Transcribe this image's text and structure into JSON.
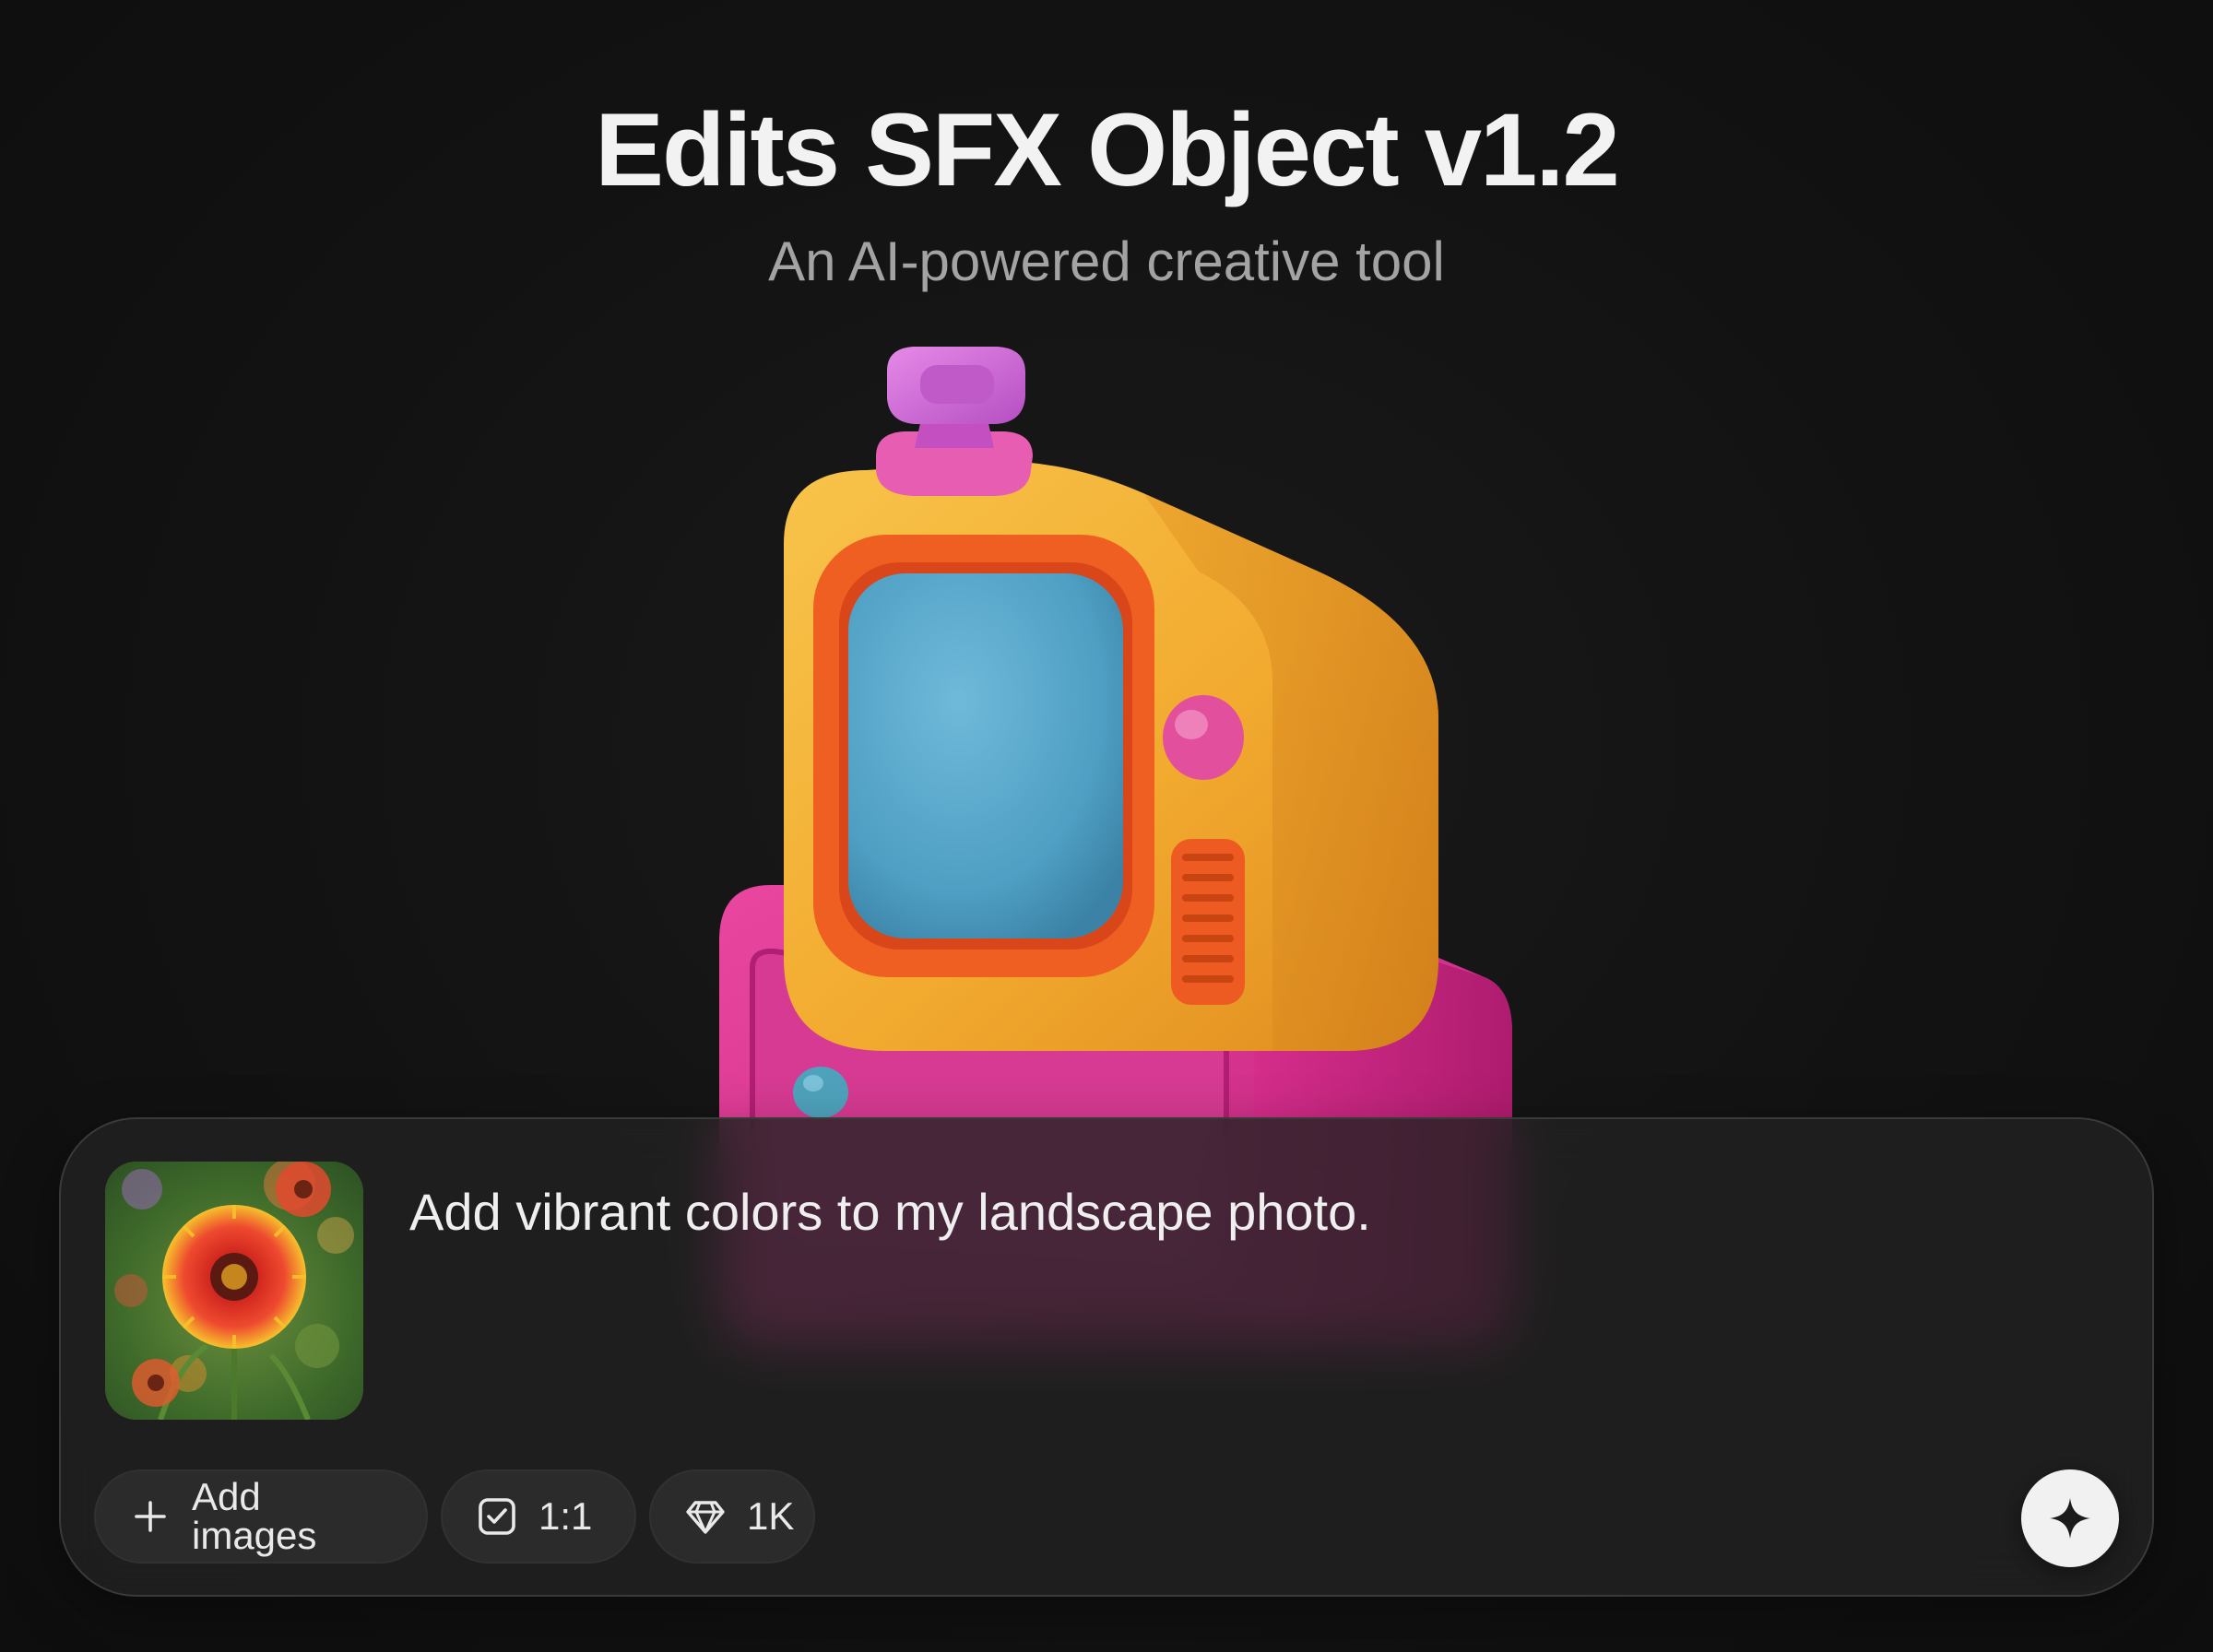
{
  "header": {
    "title": "Edits SFX Object v1.2",
    "subtitle": "An AI-powered creative tool"
  },
  "hero": {
    "image_icon": "retro-tv-3d-icon",
    "colors": {
      "tv_body": "#F2AA2F",
      "tv_bezel": "#F05F22",
      "screen": "#4E9FC3",
      "cabinet": "#D92D8E",
      "antenna": "#D065D8",
      "knob": "#E24F9C",
      "drawer_knob": "#4FA2BC"
    }
  },
  "composer": {
    "thumbnail_icon": "flower-photo-thumbnail",
    "prompt_text": "Add vibrant colors to my landscape photo.",
    "chips": [
      {
        "label": "Add images",
        "icon": "plus-icon"
      },
      {
        "label": "1:1",
        "icon": "checkbox-square-icon"
      },
      {
        "label": "1K",
        "icon": "diamond-icon"
      }
    ],
    "send_button": {
      "icon": "sparkle-icon"
    }
  },
  "theme": {
    "background": "#121212",
    "panel": "#222222",
    "chip_background": "#2B2B2B",
    "text_primary": "#F2F2F2",
    "text_secondary": "#A3A3A3",
    "send_button": "#F1F1F1"
  }
}
